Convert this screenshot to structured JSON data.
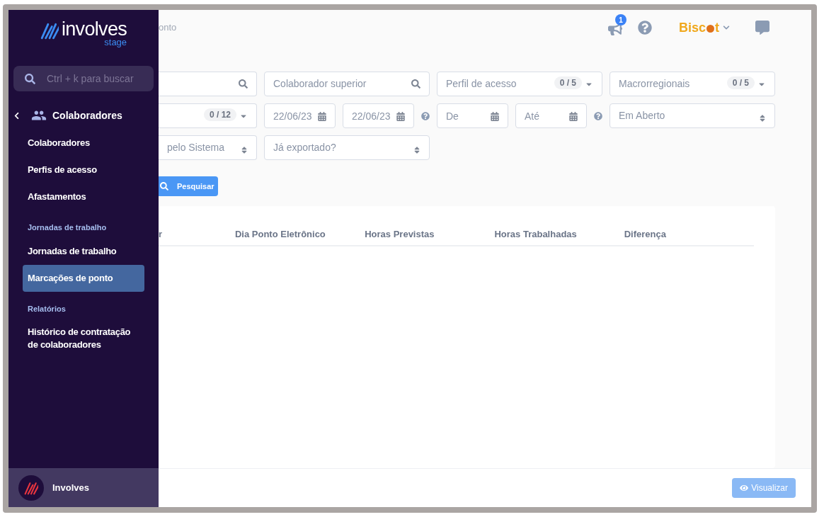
{
  "sidebar": {
    "logo": "involves",
    "logo_sub": "stage",
    "search": {
      "placeholder": "Ctrl + k para buscar"
    },
    "section_title": "Colaboradores",
    "items": [
      {
        "kind": "item",
        "label": "Colaboradores",
        "selected": false
      },
      {
        "kind": "item",
        "label": "Perfis de acesso",
        "selected": false
      },
      {
        "kind": "item",
        "label": "Afastamentos",
        "selected": false
      },
      {
        "kind": "heading",
        "label": "Jornadas de trabalho"
      },
      {
        "kind": "item",
        "label": "Jornadas de trabalho",
        "selected": false
      },
      {
        "kind": "item",
        "label": "Marcações de ponto",
        "selected": true
      },
      {
        "kind": "heading",
        "label": "Relatórios"
      },
      {
        "kind": "item",
        "label": "Histórico de contratação de colaboradores",
        "selected": false
      }
    ],
    "footer": {
      "label": "Involves"
    }
  },
  "header": {
    "breadcrumb": "onto",
    "notifications_badge": "1",
    "brand_start": "Bisc",
    "brand_end": "t"
  },
  "filters": [
    [
      {
        "kind": "search"
      },
      {
        "kind": "search",
        "placeholder": "Colaborador superior"
      },
      {
        "kind": "multiselect",
        "placeholder": "Perfil de acesso",
        "count": "0 / 5"
      },
      {
        "kind": "multiselect",
        "placeholder": "Macrorregionais",
        "count": "0 / 5"
      }
    ],
    [
      {
        "kind": "multiselect",
        "count": "0 / 12"
      },
      {
        "kind": "date",
        "value": "22/06/23"
      },
      {
        "kind": "date",
        "value": "22/06/23"
      },
      {
        "kind": "help"
      },
      {
        "kind": "date",
        "placeholder": "De"
      },
      {
        "kind": "date",
        "placeholder": "Até"
      },
      {
        "kind": "help"
      },
      {
        "kind": "select",
        "value": "Em Aberto"
      }
    ],
    [
      {
        "kind": "select",
        "value": "pelo Sistema"
      },
      {
        "kind": "select",
        "placeholder": "Já exportado?"
      }
    ]
  ],
  "search_button": "Pesquisar",
  "table": {
    "columns": [
      "r",
      "Dia Ponto Eletrônico",
      "Horas Previstas",
      "Horas Trabalhadas",
      "Diferença"
    ]
  },
  "footer": {
    "button": {
      "label": "Visualizar",
      "disabled": true
    }
  }
}
